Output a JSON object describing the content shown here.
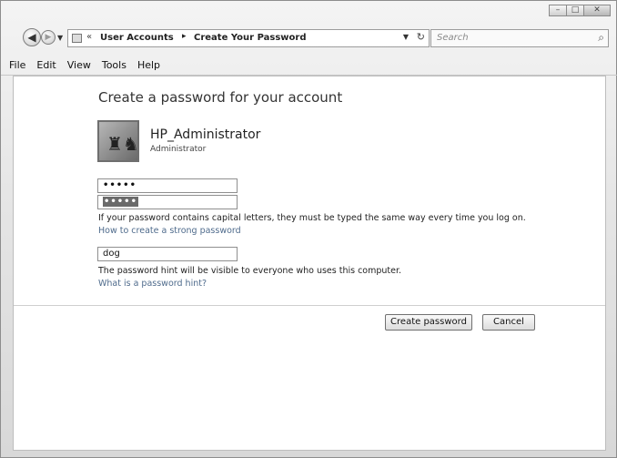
{
  "address_bar": {
    "chevron": "«",
    "crumbs": [
      "User Accounts",
      "Create Your Password"
    ],
    "separator": "▸"
  },
  "search": {
    "placeholder": "Search"
  },
  "menu": [
    "File",
    "Edit",
    "View",
    "Tools",
    "Help"
  ],
  "page": {
    "heading": "Create a password for your account",
    "user": {
      "name": "HP_Administrator",
      "role": "Administrator"
    },
    "new_password": "•••••",
    "confirm_password": "•••••",
    "caps_note": "If your password contains capital letters, they must be typed the same way every time you log on.",
    "strong_link": "How to create a strong password",
    "hint_value": "dog",
    "hint_note": "The password hint will be visible to everyone who uses this computer.",
    "hint_link": "What is a password hint?"
  },
  "buttons": {
    "create": "Create password",
    "cancel": "Cancel"
  }
}
